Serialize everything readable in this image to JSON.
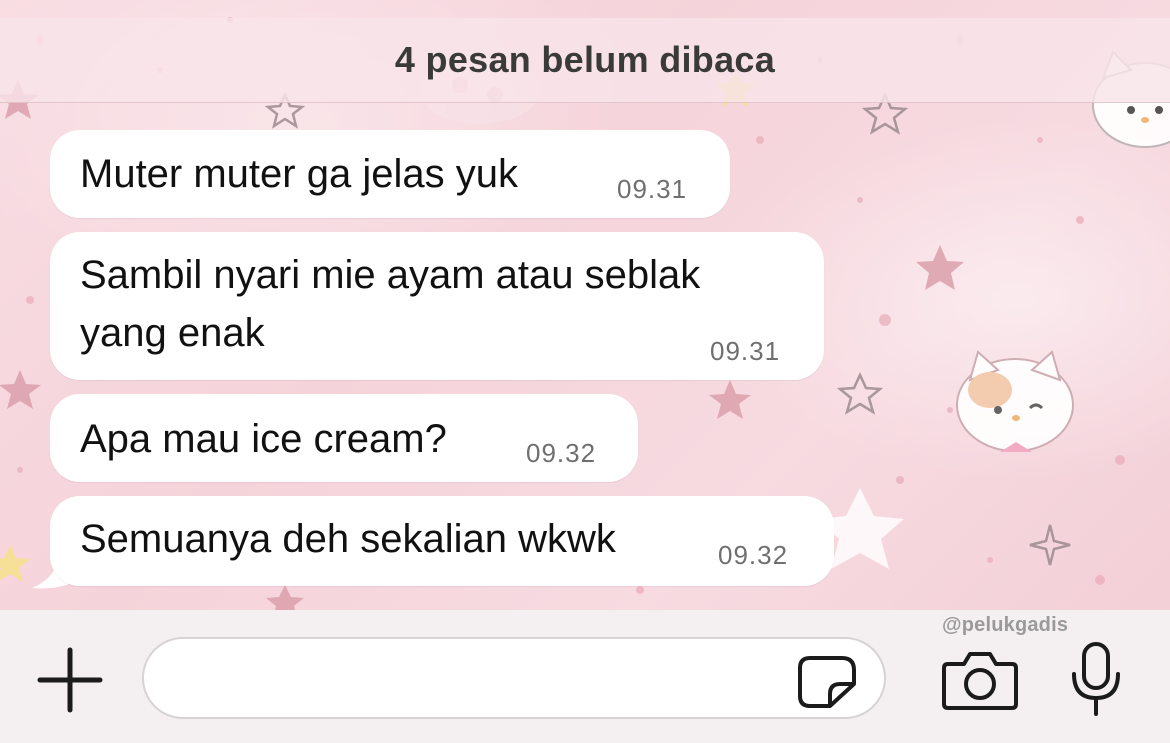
{
  "unread_banner": "4 pesan belum dibaca",
  "messages": [
    {
      "text_lines": [
        "Muter muter ga jelas yuk"
      ],
      "time": "09.31"
    },
    {
      "text_lines": [
        "Sambil nyari mie ayam atau seblak",
        "yang enak"
      ],
      "time": "09.31"
    },
    {
      "text_lines": [
        "Apa mau ice cream?"
      ],
      "time": "09.32"
    },
    {
      "text_lines": [
        "Semuanya deh sekalian wkwk"
      ],
      "time": "09.32"
    }
  ],
  "input": {
    "value": "",
    "placeholder": ""
  },
  "icons": {
    "add": "plus-icon",
    "sticker": "sticker-icon",
    "camera": "camera-icon",
    "mic": "microphone-icon"
  },
  "watermark": "@pelukgadis",
  "colors": {
    "wallpaper": "#f5d3da",
    "bubble": "#ffffff",
    "input_bar": "#f4f0f1"
  }
}
